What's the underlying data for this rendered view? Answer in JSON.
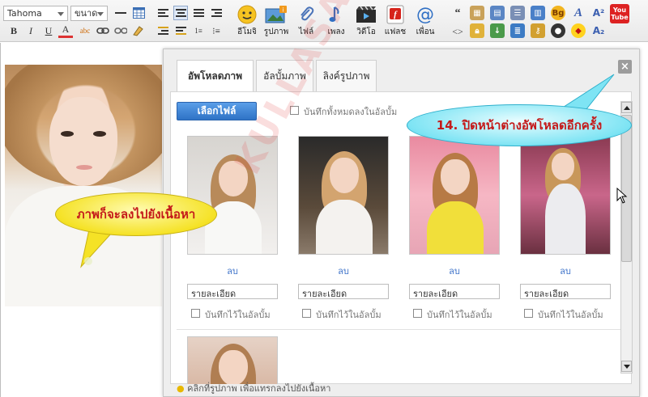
{
  "toolbar": {
    "font_name": "Tahoma",
    "font_size": "ขนาด",
    "formatting": [
      "B",
      "I",
      "U",
      "A"
    ],
    "big_buttons": [
      {
        "label": "อีโมจิ",
        "icon": "emoji-icon"
      },
      {
        "label": "รูปภาพ",
        "icon": "image-icon"
      },
      {
        "label": "ไฟล์",
        "icon": "paperclip-icon"
      },
      {
        "label": "เพลง",
        "icon": "music-icon"
      },
      {
        "label": "วิดีโอ",
        "icon": "video-icon"
      },
      {
        "label": "แฟลช",
        "icon": "flash-icon"
      },
      {
        "label": "เพื่อน",
        "icon": "at-icon"
      }
    ],
    "small_labels": {
      "bg": "Bg",
      "a2": "A²",
      "a_sub": "A₂",
      "youtube": "You Tube"
    }
  },
  "dialog": {
    "tabs": [
      "อัพโหลดภาพ",
      "อัลบั้มภาพ",
      "ลิงค์รูปภาพ"
    ],
    "choose_file": "เลือกไฟล์",
    "save_all_label": "บันทึกทั้งหมดลงในอัลบั้ม",
    "close_label": "×",
    "items": [
      {
        "delete": "ลบ",
        "description": "รายละเอียด",
        "save_label": "บันทึกไว้ในอัลบั้ม"
      },
      {
        "delete": "ลบ",
        "description": "รายละเอียด",
        "save_label": "บันทึกไว้ในอัลบั้ม"
      },
      {
        "delete": "ลบ",
        "description": "รายละเอียด",
        "save_label": "บันทึกไว้ในอัลบั้ม"
      },
      {
        "delete": "ลบ",
        "description": "รายละเอียด",
        "save_label": "บันทึกไว้ในอัลบั้ม"
      }
    ],
    "hint": "คลิกที่รูปภาพ เพื่อแทรกลงไปยังเนื้อหา"
  },
  "callouts": {
    "content_note": "ภาพก็จะลงไปยังเนื้อหา",
    "close_note": "14. ปิดหน้าต่างอัพโหลดอีกครั้ง"
  },
  "watermark": "KULLASAP.NET"
}
